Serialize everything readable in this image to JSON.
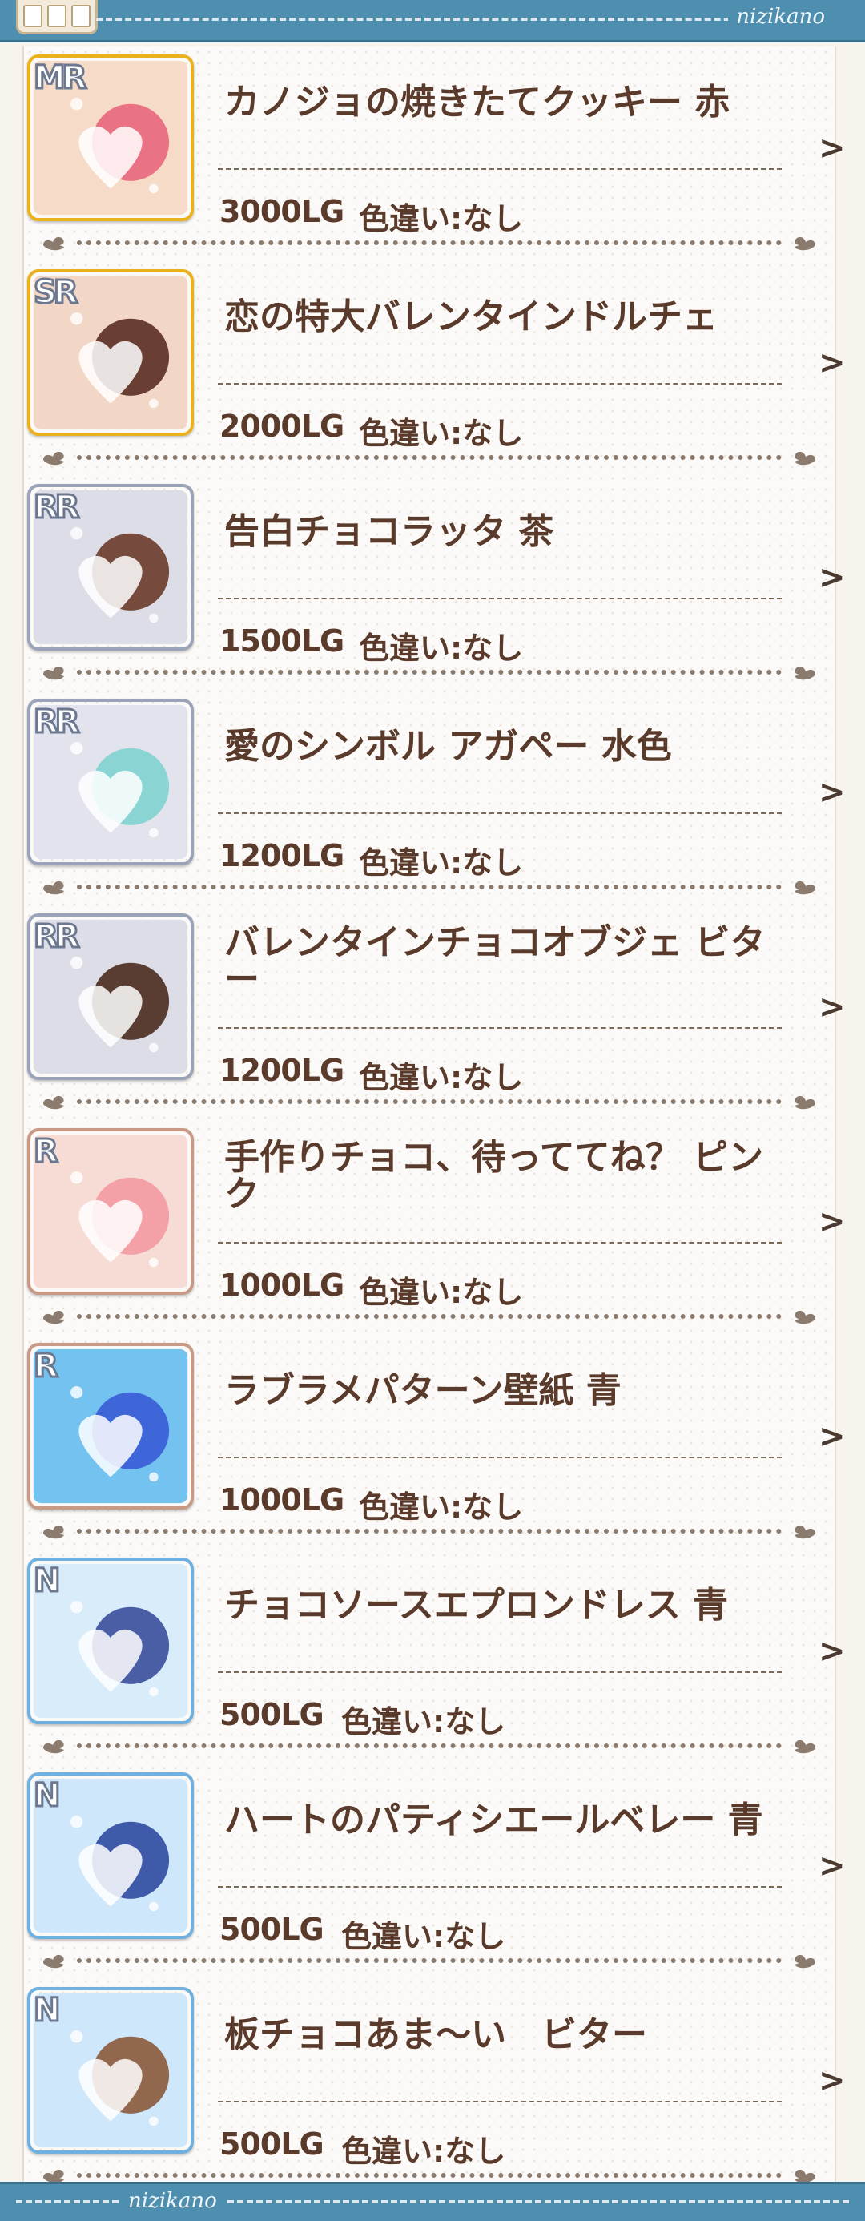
{
  "header": {
    "brand": "nizikano"
  },
  "footer": {
    "brand": "nizikano"
  },
  "items": [
    {
      "rarity": "MR",
      "name": "カノジョの焼きたてクッキー 赤",
      "price": "3000LG",
      "variant": "色違い:なし",
      "frame": "#e9b21c",
      "bg": "#f6dcc8",
      "accent": "#e8677c"
    },
    {
      "rarity": "SR",
      "name": "恋の特大バレンタインドルチェ",
      "price": "2000LG",
      "variant": "色違い:なし",
      "frame": "#e9b21c",
      "bg": "#f3d7c6",
      "accent": "#5a2f22"
    },
    {
      "rarity": "RR",
      "name": "告白チョコラッタ 茶",
      "price": "1500LG",
      "variant": "色違い:なし",
      "frame": "#9aa3b8",
      "bg": "#dcdde6",
      "accent": "#6a3a2a"
    },
    {
      "rarity": "RR",
      "name": "愛のシンボル アガペー 水色",
      "price": "1200LG",
      "variant": "色違い:なし",
      "frame": "#9aa3b8",
      "bg": "#e3e3ee",
      "accent": "#7fd3cf"
    },
    {
      "rarity": "RR",
      "name": "バレンタインチョコオブジェ ビター",
      "price": "1200LG",
      "variant": "色違い:なし",
      "frame": "#9aa3b8",
      "bg": "#dcdde6",
      "accent": "#4a2a1e"
    },
    {
      "rarity": "R",
      "name": "手作りチョコ、待っててね？ ピンク",
      "price": "1000LG",
      "variant": "色違い:なし",
      "frame": "#c89a86",
      "bg": "#f7dcd6",
      "accent": "#f29aa2"
    },
    {
      "rarity": "R",
      "name": "ラブラメパターン壁紙 青",
      "price": "1000LG",
      "variant": "色違い:なし",
      "frame": "#c89a86",
      "bg": "#73c2f0",
      "accent": "#3a5cd6"
    },
    {
      "rarity": "N",
      "name": "チョコソースエプロンドレス 青",
      "price": "500LG",
      "variant": "色違い:なし",
      "frame": "#6fb0e0",
      "bg": "#d8ecfa",
      "accent": "#3a4f9a"
    },
    {
      "rarity": "N",
      "name": "ハートのパティシエールベレー 青",
      "price": "500LG",
      "variant": "色違い:なし",
      "frame": "#6fb0e0",
      "bg": "#cfe7fa",
      "accent": "#2f4aa0"
    },
    {
      "rarity": "N",
      "name": "板チョコあま～い　ビター",
      "price": "500LG",
      "variant": "色違い:なし",
      "frame": "#6fb0e0",
      "bg": "#cfe7fa",
      "accent": "#8a5a3a"
    }
  ]
}
